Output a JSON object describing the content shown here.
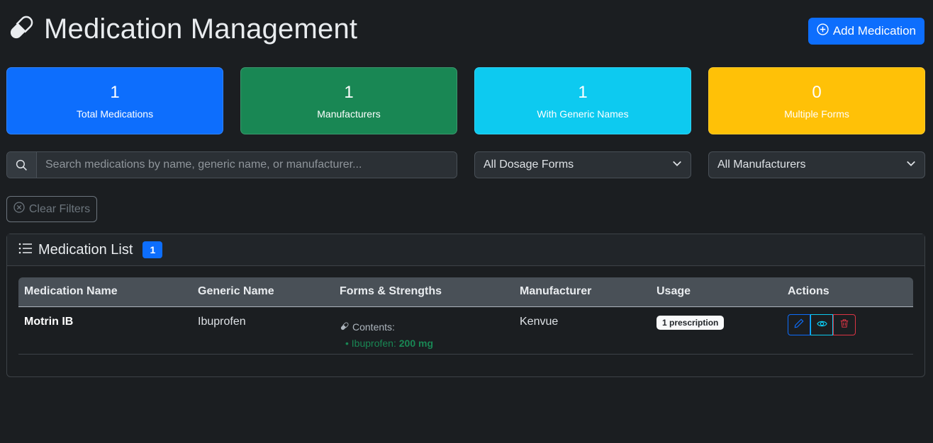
{
  "header": {
    "title": "Medication Management",
    "add_button_label": "Add Medication"
  },
  "stats": [
    {
      "value": "1",
      "label": "Total Medications",
      "color": "#0d6efd"
    },
    {
      "value": "1",
      "label": "Manufacturers",
      "color": "#198754"
    },
    {
      "value": "1",
      "label": "With Generic Names",
      "color": "#0dcaf0"
    },
    {
      "value": "0",
      "label": "Multiple Forms",
      "color": "#ffc107"
    }
  ],
  "filters": {
    "search_placeholder": "Search medications by name, generic name, or manufacturer...",
    "dosage_forms_selected": "All Dosage Forms",
    "manufacturers_selected": "All Manufacturers",
    "clear_label": "Clear Filters"
  },
  "list": {
    "title": "Medication List",
    "count": "1",
    "columns": [
      "Medication Name",
      "Generic Name",
      "Forms & Strengths",
      "Manufacturer",
      "Usage",
      "Actions"
    ],
    "rows": [
      {
        "name": "Motrin IB",
        "generic": "Ibuprofen",
        "contents_label": "Contents:",
        "ingredient_name": "Ibuprofen:",
        "ingredient_strength": "200 mg",
        "manufacturer": "Kenvue",
        "usage": "1 prescription"
      }
    ]
  },
  "icons": {
    "title": "pill-icon",
    "add": "plus-circle-icon",
    "search": "search-icon",
    "clear": "x-circle-icon",
    "list": "list-icon",
    "edit": "pencil-icon",
    "view": "eye-icon",
    "delete": "trash-icon"
  }
}
